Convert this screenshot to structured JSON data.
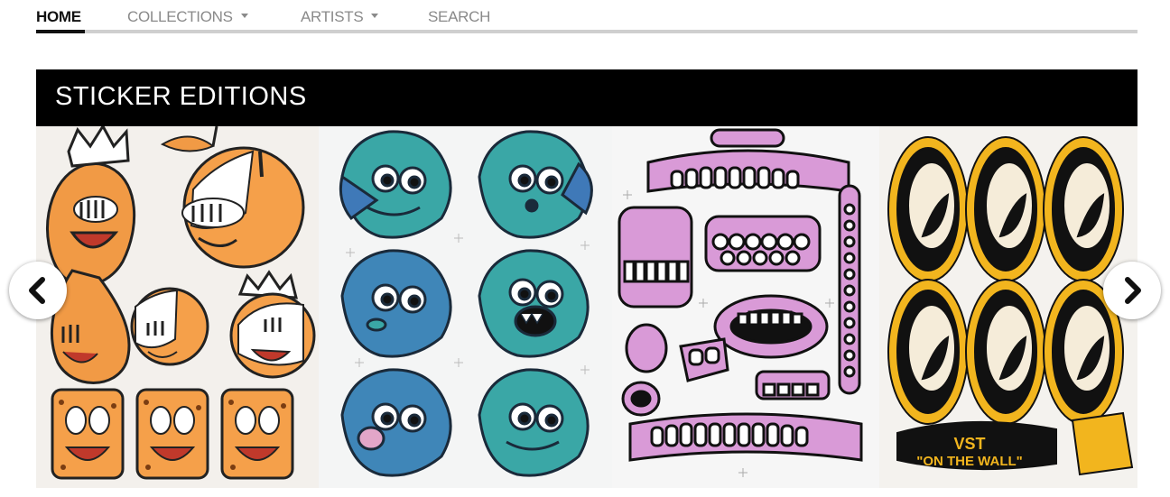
{
  "nav": {
    "items": [
      {
        "label": "HOME",
        "active": true,
        "has_dropdown": false
      },
      {
        "label": "COLLECTIONS",
        "active": false,
        "has_dropdown": true
      },
      {
        "label": "ARTISTS",
        "active": false,
        "has_dropdown": true
      },
      {
        "label": "SEARCH",
        "active": false,
        "has_dropdown": false
      }
    ]
  },
  "banner": {
    "title": "STICKER EDITIONS"
  },
  "carousel": {
    "prev_icon": "chevron-left-icon",
    "next_icon": "chevron-right-icon",
    "slides": [
      {
        "subject": "fruit and cracker character stickers"
      },
      {
        "subject": "teal blue creature head stickers"
      },
      {
        "subject": "pink teeth and gums stickers"
      },
      {
        "subject": "yellow eyes stickers",
        "sticker_text": [
          "VST",
          "\"ON THE WALL\""
        ]
      }
    ]
  },
  "colors": {
    "banner_bg": "#000000",
    "nav_active": "#111111",
    "nav_inactive": "#8a8a8a",
    "nav_rule": "#cfcfcf"
  }
}
